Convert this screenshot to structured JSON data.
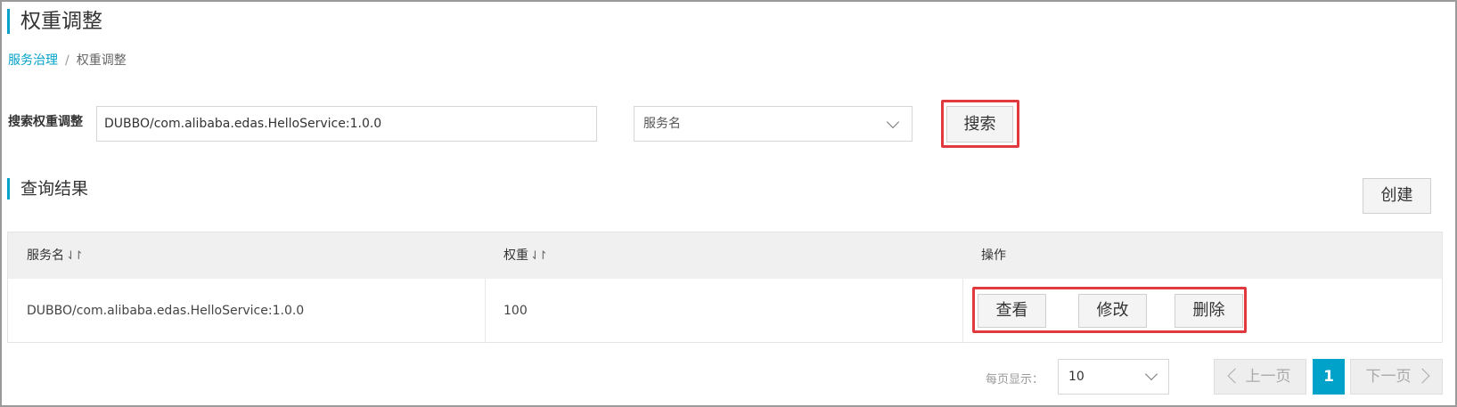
{
  "page": {
    "title": "权重调整"
  },
  "breadcrumb": {
    "parent": "服务治理",
    "separator": "/",
    "current": "权重调整"
  },
  "search": {
    "label": "搜索权重调整",
    "value": "DUBBO/com.alibaba.edas.HelloService:1.0.0",
    "select_value": "服务名",
    "button_label": "搜索"
  },
  "results": {
    "title": "查询结果",
    "create_label": "创建"
  },
  "table": {
    "columns": [
      {
        "label": "服务名",
        "sortable": true
      },
      {
        "label": "权重",
        "sortable": true
      },
      {
        "label": "操作",
        "sortable": false
      }
    ],
    "sort_icon": "⇃↾",
    "rows": [
      {
        "service": "DUBBO/com.alibaba.edas.HelloService:1.0.0",
        "weight": "100",
        "actions": {
          "view": "查看",
          "edit": "修改",
          "delete": "删除"
        }
      }
    ]
  },
  "pagination": {
    "page_size_label": "每页显示：",
    "page_size": "10",
    "prev_label": "上一页",
    "current_page": "1",
    "next_label": "下一页"
  },
  "colors": {
    "accent": "#00a2ca",
    "highlight": "#e0393e",
    "header_bg": "#f0f0f0"
  }
}
